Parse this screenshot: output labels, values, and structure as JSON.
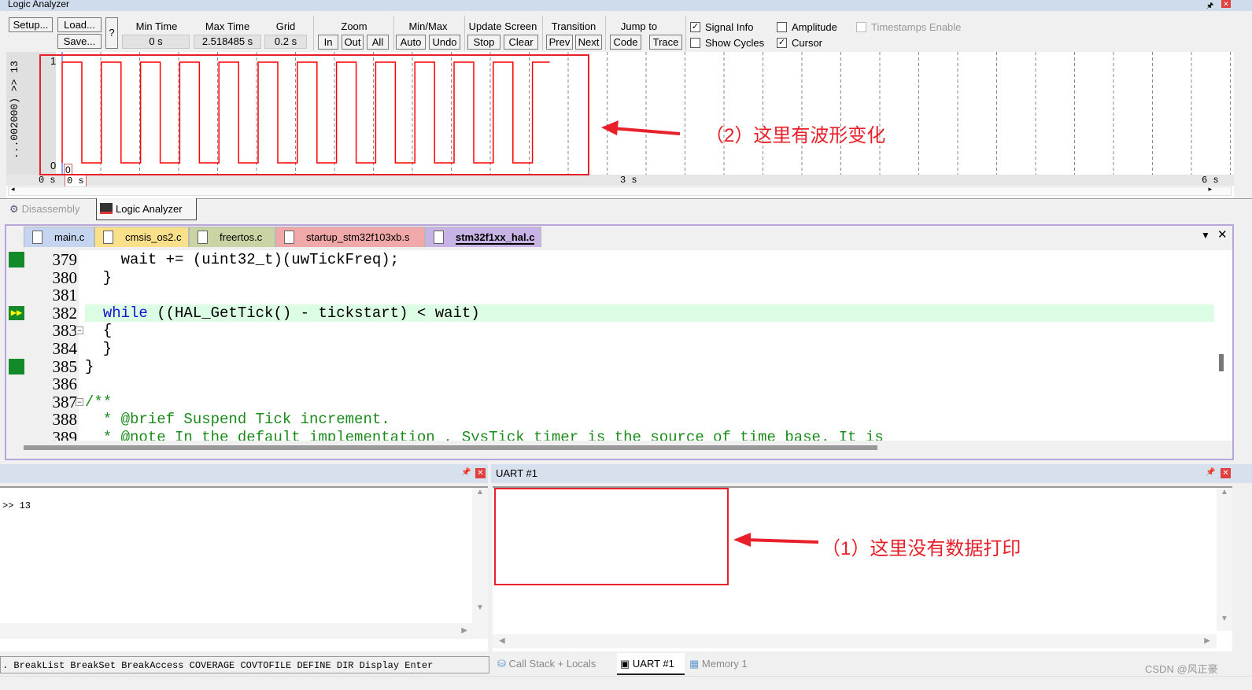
{
  "window": {
    "title": "Logic Analyzer"
  },
  "toolbar": {
    "setup": "Setup...",
    "load": "Load...",
    "save": "Save...",
    "help": "?",
    "min_time_label": "Min Time",
    "min_time": "0 s",
    "max_time_label": "Max Time",
    "max_time": "2.518485 s",
    "grid_label": "Grid",
    "grid": "0.2 s",
    "zoom_label": "Zoom",
    "zoom_in": "In",
    "zoom_out": "Out",
    "zoom_all": "All",
    "minmax_label": "Min/Max",
    "auto": "Auto",
    "undo": "Undo",
    "update_label": "Update Screen",
    "stop": "Stop",
    "clear": "Clear",
    "transition_label": "Transition",
    "prev": "Prev",
    "next": "Next",
    "jump_label": "Jump to",
    "code": "Code",
    "trace": "Trace",
    "signal_info": "Signal Info",
    "show_cycles": "Show Cycles",
    "amplitude": "Amplitude",
    "cursor": "Cursor",
    "timestamps": "Timestamps Enable",
    "signal_info_checked": true,
    "show_cycles_checked": false,
    "amplitude_checked": false,
    "cursor_checked": true,
    "timestamps_checked": false
  },
  "analyzer": {
    "signal_name": "...002000) >> 13",
    "y_high": "1",
    "y_low": "0",
    "cursor_value": "0",
    "time_labels": [
      "0 s",
      "0 s",
      "3 s",
      "6 s"
    ],
    "pulse_count": 13,
    "waveform_color": "#ff0000"
  },
  "view_tabs": [
    {
      "label": "Disassembly",
      "active": false
    },
    {
      "label": "Logic Analyzer",
      "active": true
    }
  ],
  "file_tabs": [
    {
      "label": "main.c",
      "color": "#c5d5ef"
    },
    {
      "label": "cmsis_os2.c",
      "color": "#fbe08c"
    },
    {
      "label": "freertos.c",
      "color": "#c8d4a4"
    },
    {
      "label": "startup_stm32f103xb.s",
      "color": "#f0a8a8"
    },
    {
      "label": "stm32f1xx_hal.c",
      "color": "#c8b4e4",
      "active": true
    }
  ],
  "code_lines": [
    {
      "n": "379",
      "text": "    wait += (uint32_t)(uwTickFreq);",
      "mark": "green"
    },
    {
      "n": "380",
      "text": "  }"
    },
    {
      "n": "381",
      "text": ""
    },
    {
      "n": "382",
      "text": "  while ((HAL_GetTick() - tickstart) < wait)",
      "mark": "current",
      "highlight": true
    },
    {
      "n": "383",
      "text": "  {",
      "fold": true
    },
    {
      "n": "384",
      "text": "  }"
    },
    {
      "n": "385",
      "text": "}",
      "mark": "green"
    },
    {
      "n": "386",
      "text": ""
    },
    {
      "n": "387",
      "text": "/**",
      "fold": true,
      "comment": true
    },
    {
      "n": "388",
      "text": "  * @brief Suspend Tick increment.",
      "comment": true
    },
    {
      "n": "389",
      "text": "  * @note In the default implementation , SysTick timer is the source of time base. It is",
      "comment": true
    }
  ],
  "command": {
    "output": ">> 13",
    "hint": ". BreakList BreakSet BreakAccess COVERAGE COVTOFILE DEFINE DIR Display Enter"
  },
  "uart": {
    "title": "UART #1",
    "content": ""
  },
  "bottom_tabs": [
    {
      "label": "Call Stack + Locals",
      "active": false
    },
    {
      "label": "UART #1",
      "active": true
    },
    {
      "label": "Memory 1",
      "active": false
    }
  ],
  "annotations": {
    "note1": "（1）这里没有数据打印",
    "note2": "（2）这里有波形变化"
  },
  "watermark": "CSDN @风正豪"
}
